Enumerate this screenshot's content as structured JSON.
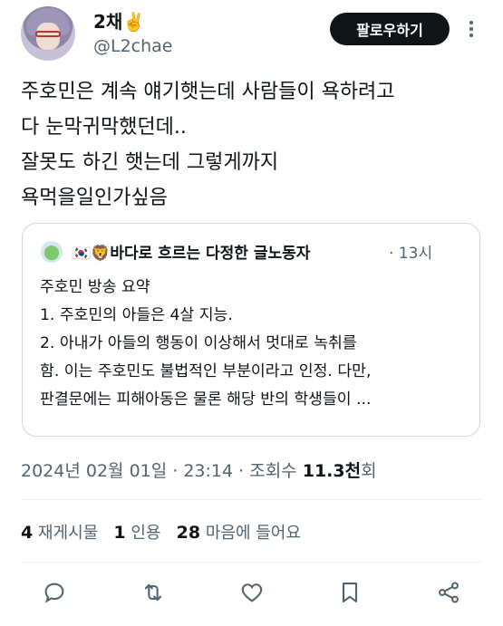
{
  "author": {
    "display_name": "2채✌️",
    "handle": "@L2chae",
    "follow_label": "팔로우하기",
    "more_icon": "more-vertical-icon"
  },
  "tweet": {
    "text": "주호민은 계속 얘기햇는데 사람들이 욕하려고\n다 눈막귀막했던데..\n잘못도 하긴 햇는데 그렇게까지\n욕먹을일인가싶음"
  },
  "quote": {
    "name": "🇰🇷🦁바다로 흐르는 다정한 글노동자",
    "time": "· 13시",
    "text": "주호민 방송 요약\n1. 주호민의 아들은 4살 지능.\n2. 아내가 아들의 행동이 이상해서 멋대로 녹취를\n함. 이는 주호민도 불법적인 부분이라고 인정. 다만,\n판결문에는 피해아동은 물론 해당 반의 학생들이 ..."
  },
  "meta": {
    "timestamp": "2024년 02월 01일 · 23:14 · 조회수",
    "views": "11.3천",
    "views_suffix": "회"
  },
  "stats": {
    "retweets_count": "4",
    "retweets_label": "재게시물",
    "quotes_count": "1",
    "quotes_label": "인용",
    "likes_count": "28",
    "likes_label": "마음에 들어요"
  },
  "colors": {
    "text": "#0f1419",
    "secondary": "#536471",
    "border": "#cfd9de",
    "button_bg": "#0f1419"
  }
}
